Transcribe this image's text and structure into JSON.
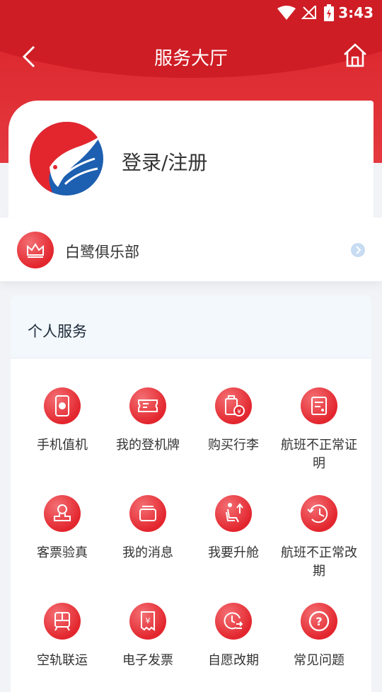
{
  "status_bar": {
    "time": "3:43"
  },
  "nav": {
    "title": "服务大厅"
  },
  "profile": {
    "login_label": "登录/注册"
  },
  "club": {
    "label": "白鹭俱乐部"
  },
  "services": {
    "title": "个人服务",
    "items": [
      {
        "label": "手机值机",
        "icon": "phone-checkin-icon"
      },
      {
        "label": "我的登机牌",
        "icon": "boarding-pass-icon"
      },
      {
        "label": "购买行李",
        "icon": "luggage-icon"
      },
      {
        "label": "航班不正常证明",
        "icon": "certificate-icon"
      },
      {
        "label": "客票验真",
        "icon": "stamp-icon"
      },
      {
        "label": "我的消息",
        "icon": "message-icon"
      },
      {
        "label": "我要升舱",
        "icon": "seat-upgrade-icon"
      },
      {
        "label": "航班不正常改期",
        "icon": "reschedule-icon"
      },
      {
        "label": "空轨联运",
        "icon": "train-icon"
      },
      {
        "label": "电子发票",
        "icon": "invoice-icon"
      },
      {
        "label": "自愿改期",
        "icon": "voluntary-change-icon"
      },
      {
        "label": "常见问题",
        "icon": "question-icon"
      }
    ]
  },
  "colors": {
    "brand_red": "#e3262e",
    "header_red": "#d9232b",
    "brand_blue": "#1d5fb0"
  }
}
